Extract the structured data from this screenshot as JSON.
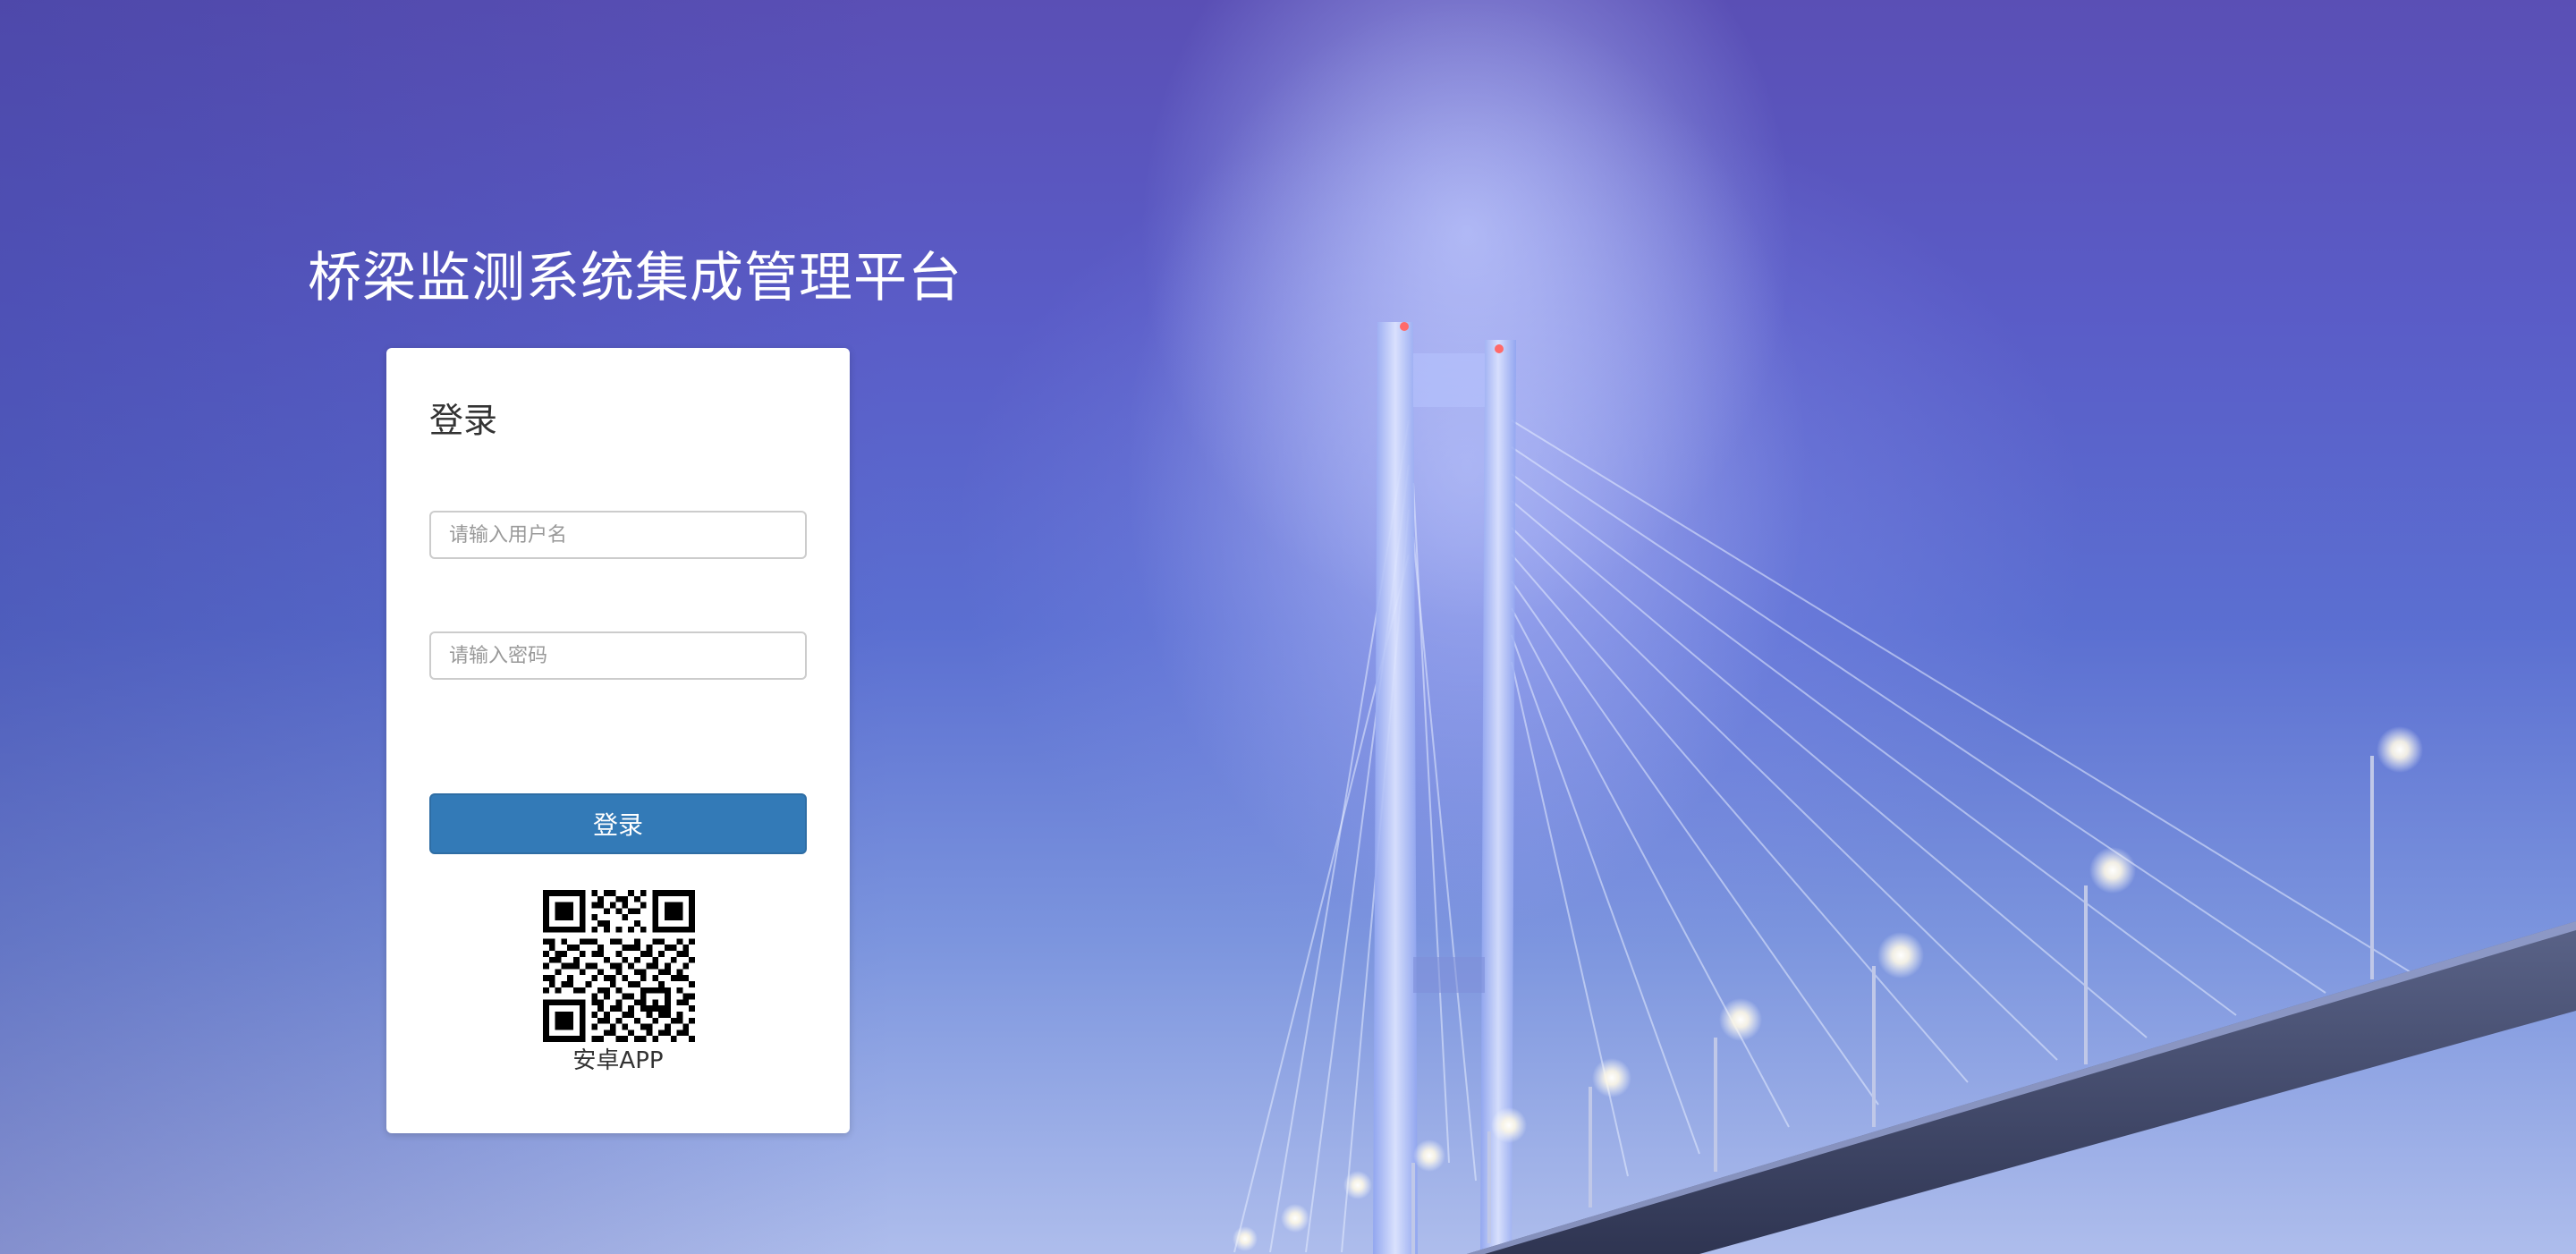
{
  "page": {
    "title": "桥梁监测系统集成管理平台"
  },
  "login": {
    "heading": "登录",
    "username_placeholder": "请输入用户名",
    "password_placeholder": "请输入密码",
    "submit_label": "登录"
  },
  "app_download": {
    "caption": "安卓APP",
    "qr_icon": "qr-code-icon"
  },
  "colors": {
    "button": "#337ab7",
    "button_border": "#2e6da4",
    "card": "#ffffff",
    "title_text": "#ffffff"
  }
}
